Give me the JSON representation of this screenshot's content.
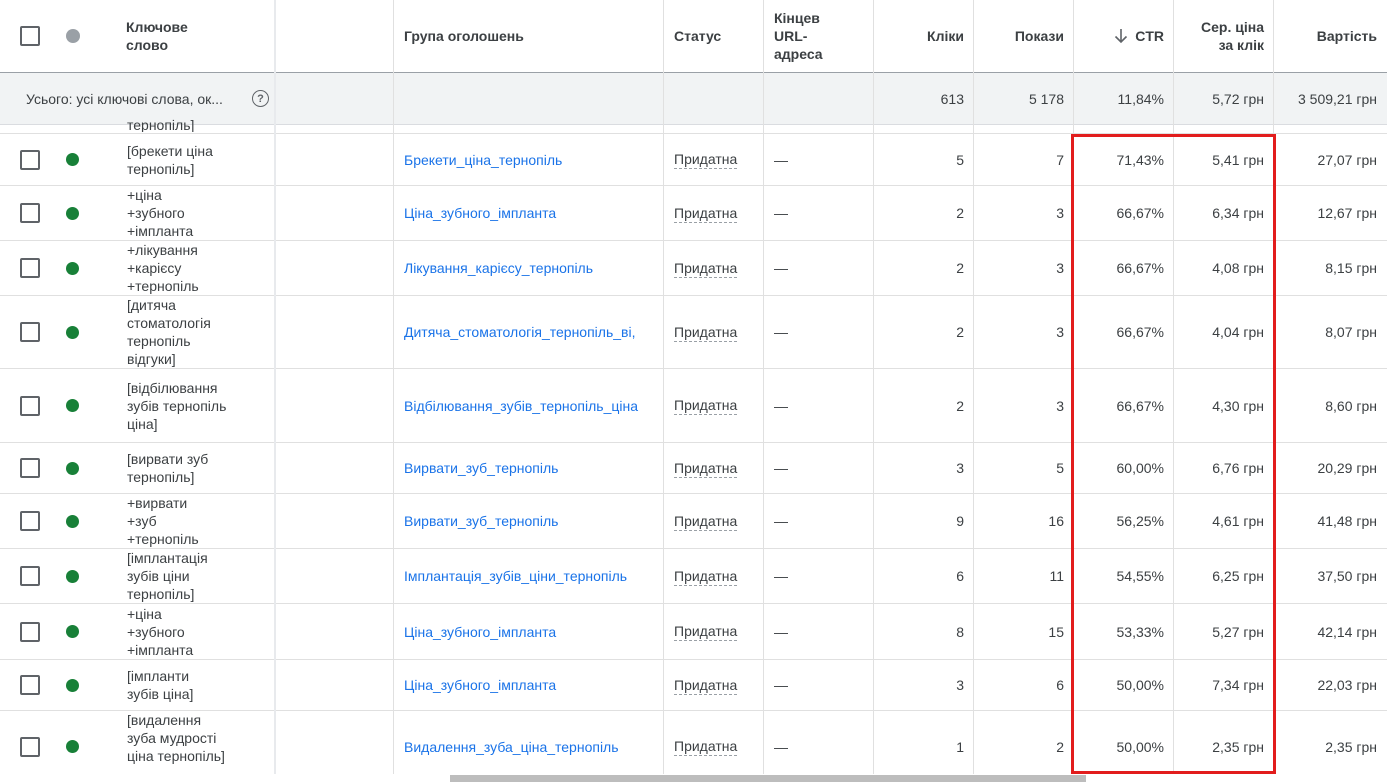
{
  "header": {
    "keyword": "Ключове слово",
    "ad_group": "Група оголошень",
    "status": "Статус",
    "final_url": "Кінцев URL-адреса",
    "clicks": "Кліки",
    "impressions": "Покази",
    "ctr": "CTR",
    "ctr_sort_icon": "arrow-down-icon",
    "avg_cpc": "Сер. ціна за клік",
    "cost": "Вартість"
  },
  "totals": {
    "label": "Усього: усі ключові слова, ок...",
    "clicks": "613",
    "impressions": "5 178",
    "ctr": "11,84%",
    "avg_cpc": "5,72 грн",
    "cost": "3 509,21 грн"
  },
  "partial_row_text": "тернопіль]",
  "rows": [
    {
      "keyword": "[брекети ціна тернопіль]",
      "ad_group": "Брекети_ціна_тернопіль",
      "status": "Придатна",
      "final_url": "—",
      "clicks": "5",
      "impressions": "7",
      "ctr": "71,43%",
      "avg_cpc": "5,41 грн",
      "cost": "27,07 грн"
    },
    {
      "keyword": "+ціна +зубного +імпланта",
      "ad_group": "Ціна_зубного_імпланта",
      "status": "Придатна",
      "final_url": "—",
      "clicks": "2",
      "impressions": "3",
      "ctr": "66,67%",
      "avg_cpc": "6,34 грн",
      "cost": "12,67 грн"
    },
    {
      "keyword": "+лікування +карієсу +тернопіль",
      "ad_group": "Лікування_карієсу_тернопіль",
      "status": "Придатна",
      "final_url": "—",
      "clicks": "2",
      "impressions": "3",
      "ctr": "66,67%",
      "avg_cpc": "4,08 грн",
      "cost": "8,15 грн"
    },
    {
      "keyword": "[дитяча стоматологія тернопіль відгуки]",
      "ad_group": "Дитяча_стоматологія_тернопіль_ві,",
      "status": "Придатна",
      "final_url": "—",
      "clicks": "2",
      "impressions": "3",
      "ctr": "66,67%",
      "avg_cpc": "4,04 грн",
      "cost": "8,07 грн"
    },
    {
      "keyword": "[відбілювання зубів тернопіль ціна]",
      "ad_group": "Відбілювання_зубів_тернопіль_ціна",
      "status": "Придатна",
      "final_url": "—",
      "clicks": "2",
      "impressions": "3",
      "ctr": "66,67%",
      "avg_cpc": "4,30 грн",
      "cost": "8,60 грн"
    },
    {
      "keyword": "[вирвати зуб тернопіль]",
      "ad_group": "Вирвати_зуб_тернопіль",
      "status": "Придатна",
      "final_url": "—",
      "clicks": "3",
      "impressions": "5",
      "ctr": "60,00%",
      "avg_cpc": "6,76 грн",
      "cost": "20,29 грн"
    },
    {
      "keyword": "+вирвати +зуб +тернопіль",
      "ad_group": "Вирвати_зуб_тернопіль",
      "status": "Придатна",
      "final_url": "—",
      "clicks": "9",
      "impressions": "16",
      "ctr": "56,25%",
      "avg_cpc": "4,61 грн",
      "cost": "41,48 грн"
    },
    {
      "keyword": "[імплантація зубів ціни тернопіль]",
      "ad_group": "Імплантація_зубів_ціни_тернопіль",
      "status": "Придатна",
      "final_url": "—",
      "clicks": "6",
      "impressions": "11",
      "ctr": "54,55%",
      "avg_cpc": "6,25 грн",
      "cost": "37,50 грн"
    },
    {
      "keyword": "+ціна +зубного +імпланта",
      "ad_group": "Ціна_зубного_імпланта",
      "status": "Придатна",
      "final_url": "—",
      "clicks": "8",
      "impressions": "15",
      "ctr": "53,33%",
      "avg_cpc": "5,27 грн",
      "cost": "42,14 грн"
    },
    {
      "keyword": "[імпланти зубів ціна]",
      "ad_group": "Ціна_зубного_імпланта",
      "status": "Придатна",
      "final_url": "—",
      "clicks": "3",
      "impressions": "6",
      "ctr": "50,00%",
      "avg_cpc": "7,34 грн",
      "cost": "22,03 грн"
    },
    {
      "keyword": "[видалення зуба мудрості ціна тернопіль]",
      "ad_group": "Видалення_зуба_ціна_тернопіль",
      "status": "Придатна",
      "final_url": "—",
      "clicks": "1",
      "impressions": "2",
      "ctr": "50,00%",
      "avg_cpc": "2,35 грн",
      "cost": "2,35 грн"
    }
  ],
  "colors": {
    "enabled_dot": "#188038",
    "link": "#1a73e8",
    "highlight_border": "#e21d1d"
  }
}
